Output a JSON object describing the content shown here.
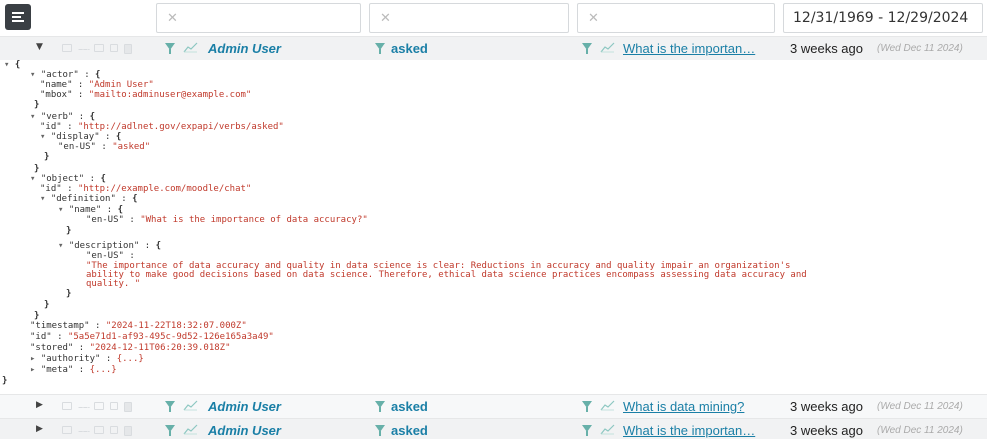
{
  "filters": {
    "actor_clear_icon": "close-icon",
    "verb_clear_icon": "close-icon",
    "object_clear_icon": "close-icon",
    "date_range": "12/31/1969 - 12/29/2024"
  },
  "rows": [
    {
      "actor": "Admin User",
      "verb": "asked",
      "object": "What is the importan…",
      "relative_time": "3 weeks ago",
      "absolute_time": "(Wed Dec 11 2024)"
    },
    {
      "actor": "Admin User",
      "verb": "asked",
      "object": "What is data mining?",
      "relative_time": "3 weeks ago",
      "absolute_time": "(Wed Dec 11 2024)"
    },
    {
      "actor": "Admin User",
      "verb": "asked",
      "object": "What is the importan…",
      "relative_time": "3 weeks ago",
      "absolute_time": "(Wed Dec 11 2024)"
    }
  ],
  "json": {
    "actor_key": "\"actor\"",
    "name_key": "\"name\"",
    "name_val": "\"Admin User\"",
    "mbox_key": "\"mbox\"",
    "mbox_val": "\"mailto:adminuser@example.com\"",
    "verb_key": "\"verb\"",
    "id_key": "\"id\"",
    "verb_id_val": "\"http://adlnet.gov/expapi/verbs/asked\"",
    "display_key": "\"display\"",
    "enus_key": "\"en-US\"",
    "display_val": "\"asked\"",
    "object_key": "\"object\"",
    "object_id_val": "\"http://example.com/moodle/chat\"",
    "definition_key": "\"definition\"",
    "def_name_val": "\"What is the importance of data accuracy?\"",
    "description_key": "\"description\"",
    "desc_line1": "\"The importance of data accuracy and quality in data science is clear: Reductions in accuracy and quality impair an organization's",
    "desc_line2": "ability to make good decisions based on data science. Therefore, ethical data science practices encompass assessing data accuracy and",
    "desc_line3": "quality. \"",
    "timestamp_key": "\"timestamp\"",
    "timestamp_val": "\"2024-11-22T18:32:07.000Z\"",
    "stmt_id_val": "\"5a5e71d1-af93-495c-9d52-126e165a3a49\"",
    "stored_key": "\"stored\"",
    "stored_val": "\"2024-12-11T06:20:39.018Z\"",
    "authority_key": "\"authority\"",
    "meta_key": "\"meta\"",
    "collapsed": "{...}"
  }
}
